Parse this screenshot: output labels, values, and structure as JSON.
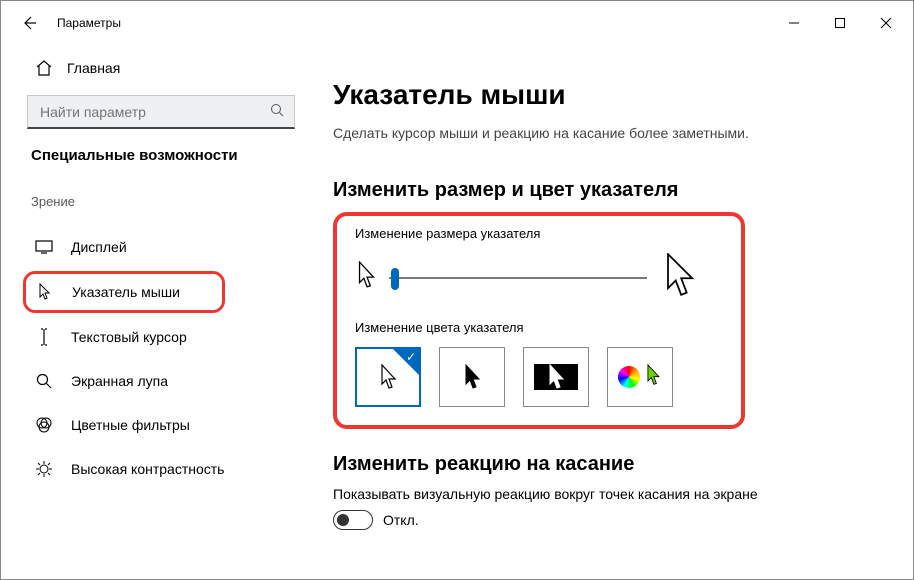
{
  "window": {
    "app_title": "Параметры"
  },
  "sidebar": {
    "home": "Главная",
    "search_placeholder": "Найти параметр",
    "section": "Специальные возможности",
    "group": "Зрение",
    "items": [
      {
        "label": "Дисплей",
        "icon": "display-icon"
      },
      {
        "label": "Указатель мыши",
        "icon": "mouse-pointer-icon",
        "active": true
      },
      {
        "label": "Текстовый курсор",
        "icon": "text-cursor-icon"
      },
      {
        "label": "Экранная лупа",
        "icon": "magnifier-icon"
      },
      {
        "label": "Цветные фильтры",
        "icon": "color-filters-icon"
      },
      {
        "label": "Высокая контрастность",
        "icon": "high-contrast-icon"
      }
    ]
  },
  "main": {
    "title": "Указатель мыши",
    "description": "Сделать курсор мыши и реакцию на касание более заметными.",
    "section_size_color": "Изменить размер и цвет указателя",
    "size_label": "Изменение размера указателя",
    "color_label": "Изменение цвета указателя",
    "color_options": [
      {
        "name": "white",
        "selected": true
      },
      {
        "name": "black",
        "selected": false
      },
      {
        "name": "inverted",
        "selected": false
      },
      {
        "name": "custom",
        "selected": false
      }
    ],
    "section_touch": "Изменить реакцию на касание",
    "touch_label": "Показывать визуальную реакцию вокруг точек касания на экране",
    "toggle_state": "Откл."
  }
}
